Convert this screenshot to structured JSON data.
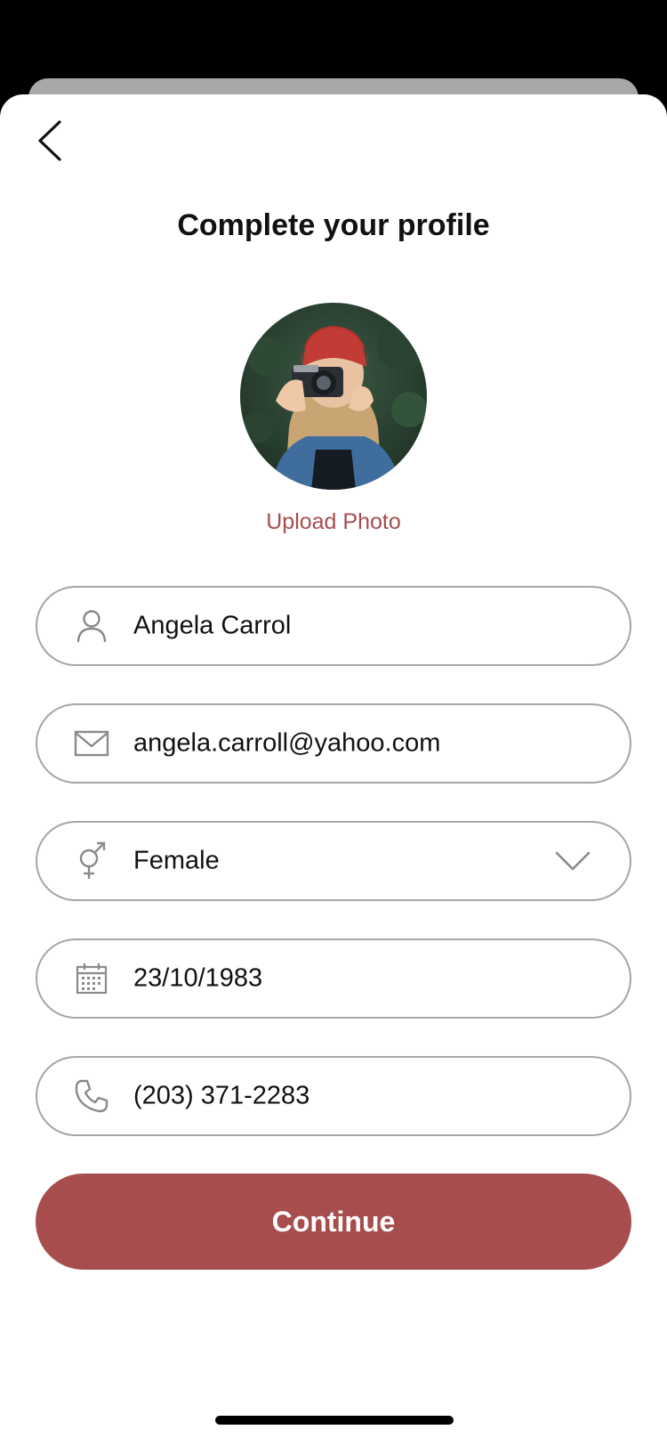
{
  "header": {
    "title": "Complete your profile",
    "back_icon": "chevron-left-icon"
  },
  "profile_photo": {
    "upload_label": "Upload Photo",
    "avatar_description_icon": "profile-avatar"
  },
  "form": {
    "name": {
      "icon": "person-icon",
      "value": "Angela Carrol"
    },
    "email": {
      "icon": "envelope-icon",
      "value": "angela.carroll@yahoo.com"
    },
    "gender": {
      "icon": "gender-icon",
      "value": "Female",
      "dropdown_icon": "chevron-down-icon"
    },
    "birthdate": {
      "icon": "calendar-icon",
      "value": "23/10/1983"
    },
    "phone": {
      "icon": "phone-icon",
      "value": "(203) 371-2283"
    }
  },
  "actions": {
    "continue_label": "Continue"
  },
  "colors": {
    "accent": "#a84d4d",
    "field_border": "#a6a6a6",
    "icon_gray": "#8a8a8a"
  }
}
